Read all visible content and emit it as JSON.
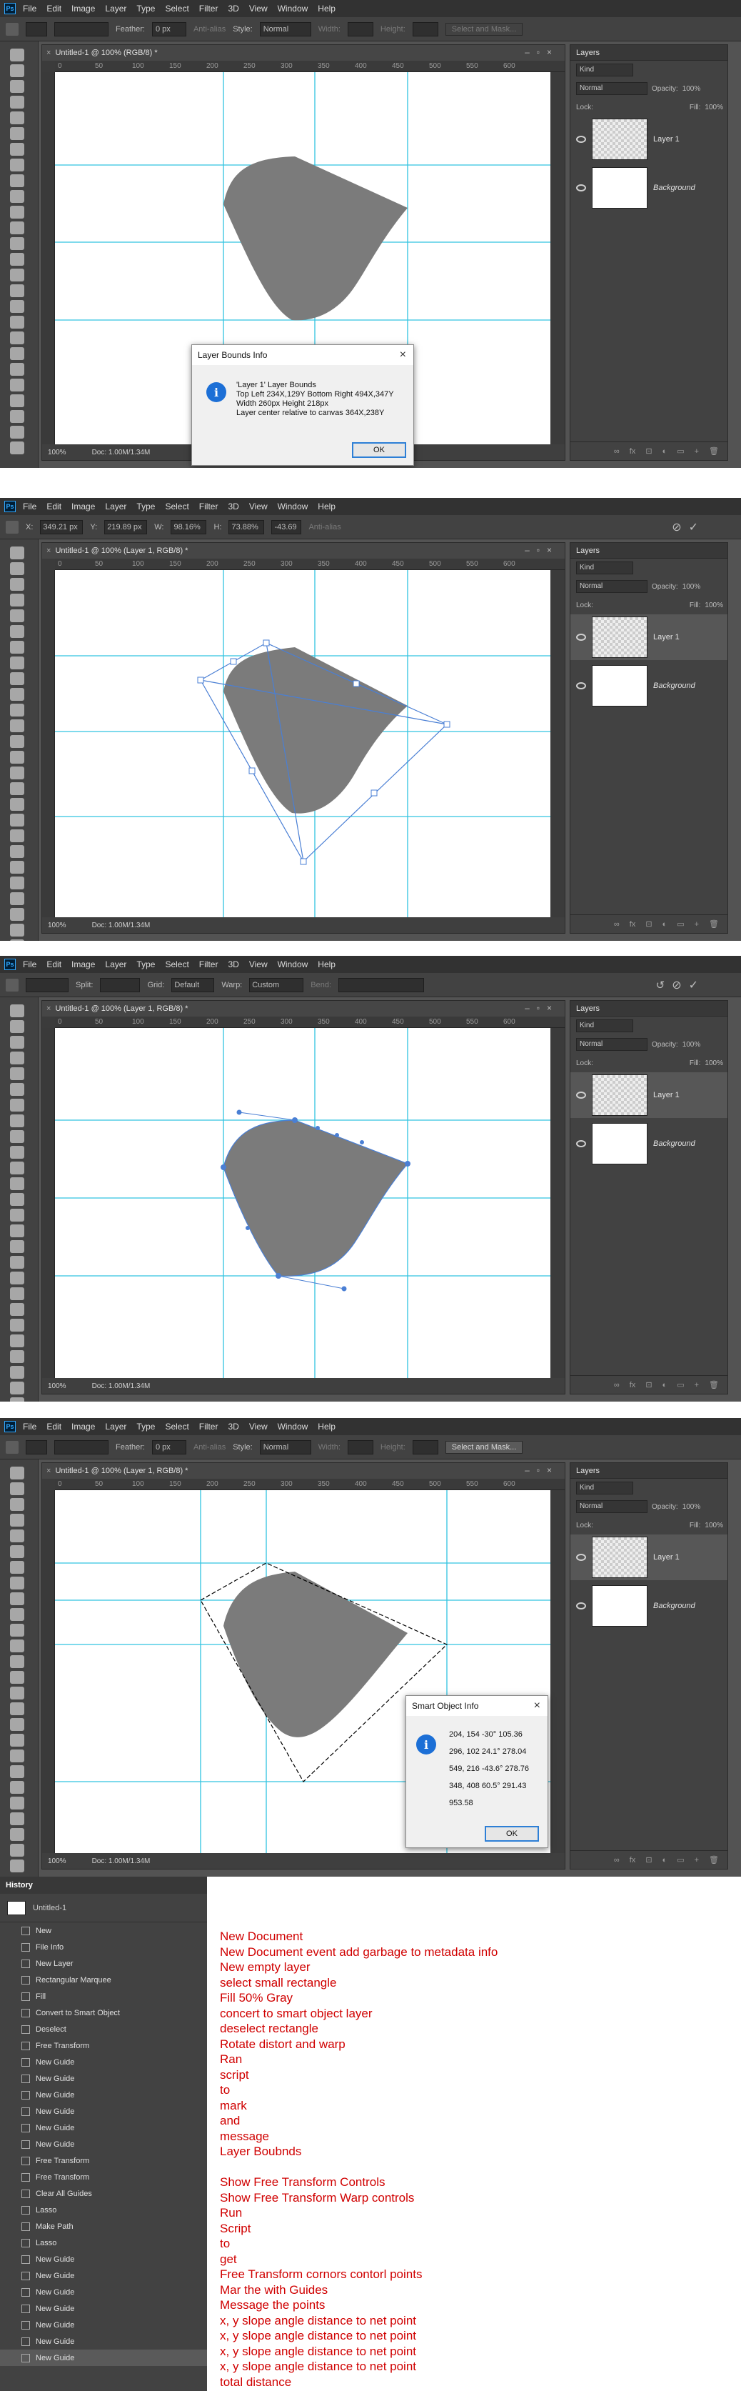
{
  "app": {
    "logo": "Ps",
    "menu": [
      "File",
      "Edit",
      "Image",
      "Layer",
      "Type",
      "Select",
      "Filter",
      "3D",
      "View",
      "Window",
      "Help"
    ]
  },
  "panel1": {
    "options": {
      "feather_label": "Feather:",
      "feather_value": "0 px",
      "antialias": "Anti-alias",
      "style_label": "Style:",
      "style_value": "Normal",
      "width_label": "Width:",
      "height_label": "Height:",
      "select_mask": "Select and Mask..."
    },
    "doc_title": "Untitled-1 @ 100% (RGB/8) *",
    "status_zoom": "100%",
    "status_doc": "Doc: 1.00M/1.34M",
    "dialog": {
      "title": "Layer Bounds Info",
      "lines": [
        "'Layer 1' Layer Bounds",
        "Top Left 234X,129Y    Bottom Right 494X,347Y",
        "Width 260px   Height 218px",
        "Layer center relative to canvas 364X,238Y"
      ],
      "ok": "OK"
    }
  },
  "panel2": {
    "options": {
      "x_label": "X:",
      "x_value": "349.21 px",
      "y_label": "Y:",
      "y_value": "219.89 px",
      "w_label": "W:",
      "w_value": "98.16%",
      "h_label": "H:",
      "h_value": "73.88%",
      "angle_value": "-43.69",
      "antialias": "Anti-alias"
    },
    "doc_title": "Untitled-1 @ 100% (Layer 1, RGB/8) *",
    "status_zoom": "100%",
    "status_doc": "Doc: 1.00M/1.34M"
  },
  "panel3": {
    "options": {
      "split_label": "Split:",
      "grid_label": "Grid:",
      "grid_value": "Default",
      "warp_label": "Warp:",
      "warp_value": "Custom",
      "bend_label": "Bend:"
    },
    "doc_title": "Untitled-1 @ 100% (Layer 1, RGB/8) *",
    "status_zoom": "100%",
    "status_doc": "Doc: 1.00M/1.34M"
  },
  "panel4": {
    "options": {
      "feather_label": "Feather:",
      "feather_value": "0 px",
      "antialias": "Anti-alias",
      "style_label": "Style:",
      "style_value": "Normal",
      "width_label": "Width:",
      "height_label": "Height:",
      "select_mask": "Select and Mask..."
    },
    "doc_title": "Untitled-1 @ 100% (Layer 1, RGB/8) *",
    "status_zoom": "100%",
    "status_doc": "Doc: 1.00M/1.34M",
    "dialog": {
      "title": "Smart Object Info",
      "lines": [
        "204, 154 -30° 105.36",
        "296, 102 24.1° 278.04",
        "549, 216 -43.6° 278.76",
        "348, 408 60.5° 291.43",
        "953.58"
      ],
      "ok": "OK"
    }
  },
  "layers_panel": {
    "tab": "Layers",
    "kind": "Kind",
    "blend": "Normal",
    "opacity_label": "Opacity:",
    "opacity_value": "100%",
    "lock_label": "Lock:",
    "fill_label": "Fill:",
    "fill_value": "100%",
    "layer1": "Layer 1",
    "background": "Background",
    "footer_icons": [
      "fx",
      "⊡",
      "◐",
      "▭",
      "+",
      "🗑"
    ]
  },
  "ruler_ticks": [
    "0",
    "50",
    "100",
    "150",
    "200",
    "250",
    "300",
    "350",
    "400",
    "450",
    "500",
    "550",
    "600"
  ],
  "history": {
    "tab": "History",
    "snapshot": "Untitled-1",
    "items": [
      "New",
      "File Info",
      "New Layer",
      "Rectangular Marquee",
      "Fill",
      "Convert to Smart Object",
      "Deselect",
      "Free Transform",
      "New Guide",
      "New Guide",
      "New Guide",
      "New Guide",
      "New Guide",
      "New Guide",
      "Free Transform",
      "Free Transform",
      "Clear All Guides",
      "Lasso",
      "Make Path",
      "Lasso",
      "New Guide",
      "New Guide",
      "New Guide",
      "New Guide",
      "New Guide",
      "New Guide",
      "New Guide"
    ]
  },
  "notes": [
    "New Document",
    "New Document event add garbage to metadata info",
    "New empty layer",
    "select small rectangle",
    "Fill 50% Gray",
    "concert to smart object layer",
    "deselect rectangle",
    "Rotate distort and warp",
    "Ran",
    "script",
    "to",
    "mark",
    "and",
    "message",
    "Layer Boubnds",
    "",
    "Show Free Transform Controls",
    "Show Free Transform Warp controls",
    "Run",
    "Script",
    "to",
    "get",
    "Free Transform cornors contorl points",
    "Mar the with Guides",
    "Message the points",
    "x, y slope angle distance to net point",
    "x, y slope angle distance to net point",
    "x, y slope angle distance to net point",
    "x, y slope angle distance to net point",
    "total distance"
  ],
  "colors": {
    "guide": "#31c3e0",
    "transform": "#4a7fd4",
    "shape": "#7b7b7b",
    "notes": "#d00000"
  }
}
